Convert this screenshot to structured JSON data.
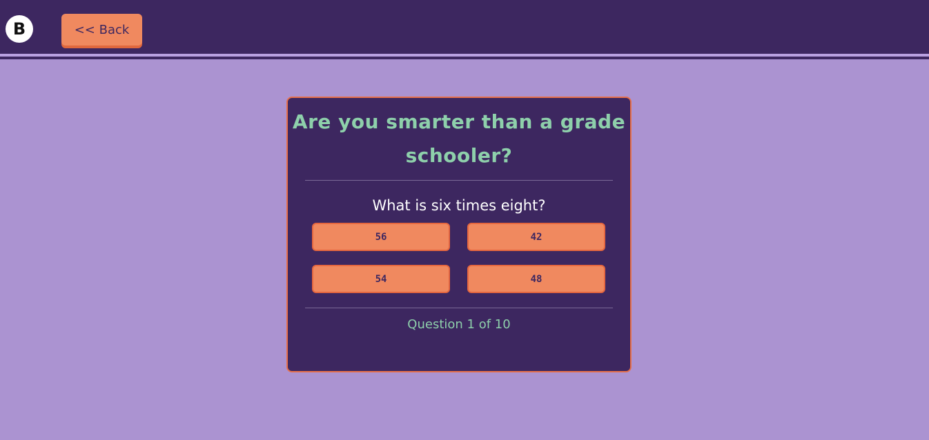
{
  "header": {
    "logo_letter": "B",
    "back_label": "<< Back"
  },
  "quiz": {
    "title": "Are you smarter than a grade schooler?",
    "question": "What is six times eight?",
    "answers": [
      "56",
      "42",
      "54",
      "48"
    ],
    "progress_text": "Question 1 of 10"
  },
  "colors": {
    "background": "#ab93d1",
    "header": "#3d2760",
    "card": "#3d2760",
    "accent_orange": "#f0895f",
    "title_green": "#8ed0ab"
  }
}
